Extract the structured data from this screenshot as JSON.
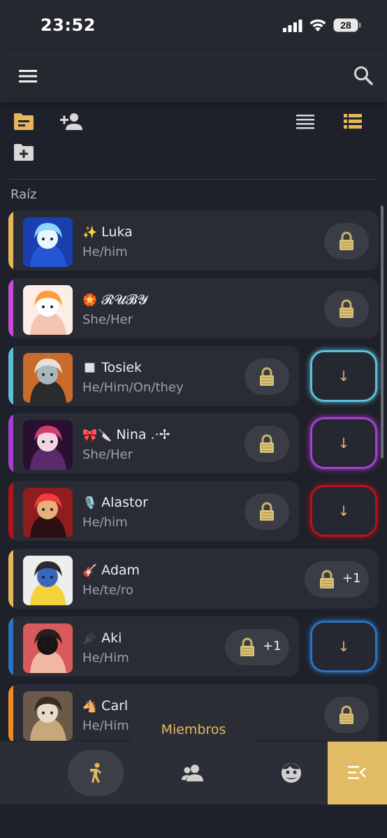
{
  "status": {
    "time": "23:52",
    "battery": "28"
  },
  "header": {
    "menu_icon": "menu-icon",
    "search_icon": "search-icon"
  },
  "toolbar": {
    "folder_icon": "folder-icon",
    "add_member_icon": "person-add-icon",
    "list_view_icon": "list-view-icon",
    "detail_view_icon": "detailed-list-icon",
    "new_folder_icon": "create-folder-icon"
  },
  "breadcrumb": {
    "root": "Raíz"
  },
  "members": [
    {
      "emoji": "✨",
      "name": "Luka",
      "pronouns": "He/him",
      "accent": "#e5b75a",
      "lock_extra": "",
      "down_color": ""
    },
    {
      "emoji": "🏵️",
      "name": "𝓡𝓤𝓑𝓨",
      "pronouns": "She/Her",
      "accent": "#c94ad6",
      "lock_extra": "",
      "down_color": ""
    },
    {
      "emoji": "◻️",
      "name": "Tosiek",
      "pronouns": "He/Him/On/they",
      "accent": "#59c0d8",
      "lock_extra": "",
      "down_color": "#59c0d8"
    },
    {
      "emoji": "🎀🔪",
      "name": "Nina .·✢",
      "pronouns": "She/Her",
      "accent": "#a73ed0",
      "lock_extra": "",
      "down_color": "#a73ed0"
    },
    {
      "emoji": "🎙️",
      "name": "Alastor",
      "pronouns": "He/him",
      "accent": "#b3141a",
      "lock_extra": "",
      "down_color": "#b3141a"
    },
    {
      "emoji": "🎸",
      "name": "Adam",
      "pronouns": "He/te/ro",
      "accent": "#e5b75a",
      "lock_extra": "+1",
      "down_color": ""
    },
    {
      "emoji": "🪮",
      "name": "Aki",
      "pronouns": "He/Him",
      "accent": "#2a73c0",
      "lock_extra": "+1",
      "down_color": "#2a73c0"
    },
    {
      "emoji": "🐴",
      "name": "Carl",
      "pronouns": "He/Him",
      "accent": "#f08a24",
      "lock_extra": "",
      "down_color": ""
    }
  ],
  "down_arrow": "↓",
  "bottom_tab": {
    "label": "Miembros"
  },
  "nav": {
    "front_icon": "fronting-person-icon",
    "groups_icon": "groups-icon",
    "friends_icon": "face-icon",
    "menu_icon": "collapse-menu-icon"
  },
  "colors": {
    "accent": "#e5b75a",
    "background": "#1f212a",
    "card": "#2a2c35"
  }
}
